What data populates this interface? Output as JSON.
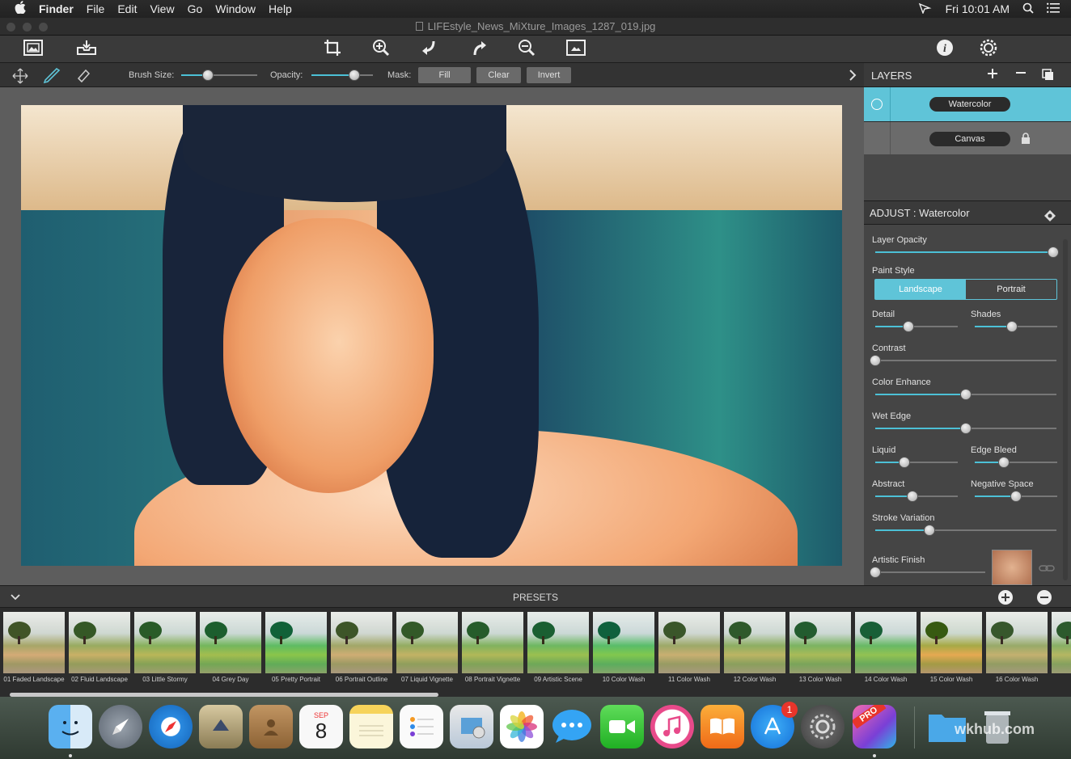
{
  "menubar": {
    "apple": "",
    "app_name": "Finder",
    "items": [
      "File",
      "Edit",
      "View",
      "Go",
      "Window",
      "Help"
    ],
    "clock": "Fri 10:01 AM"
  },
  "window": {
    "title": "LIFEstyle_News_MiXture_Images_1287_019.jpg"
  },
  "brushbar": {
    "brush_size_label": "Brush Size:",
    "brush_size": 0.35,
    "opacity_label": "Opacity:",
    "opacity": 0.7,
    "mask_label": "Mask:",
    "fill_label": "Fill",
    "clear_label": "Clear",
    "invert_label": "Invert"
  },
  "layers": {
    "title": "LAYERS",
    "items": [
      {
        "label": "Watercolor"
      },
      {
        "label": "Canvas"
      }
    ]
  },
  "adjust": {
    "title": "ADJUST : Watercolor",
    "layer_opacity_label": "Layer Opacity",
    "layer_opacity": 0.98,
    "paint_style_label": "Paint Style",
    "paint_style_options": [
      "Landscape",
      "Portrait"
    ],
    "paint_style_selected": "Landscape",
    "detail_label": "Detail",
    "detail": 0.4,
    "shades_label": "Shades",
    "shades": 0.45,
    "contrast_label": "Contrast",
    "contrast": 0.0,
    "color_enhance_label": "Color Enhance",
    "color_enhance": 0.5,
    "wet_edge_label": "Wet Edge",
    "wet_edge": 0.5,
    "liquid_label": "Liquid",
    "liquid": 0.35,
    "edge_bleed_label": "Edge Bleed",
    "edge_bleed": 0.35,
    "abstract_label": "Abstract",
    "abstract": 0.45,
    "negative_space_label": "Negative Space",
    "negative_space": 0.5,
    "stroke_variation_label": "Stroke Variation",
    "stroke_variation": 0.3,
    "artistic_finish_label": "Artistic Finish",
    "artistic_finish": 0.0
  },
  "presets": {
    "title": "PRESETS",
    "items": [
      "01 Faded Landscape",
      "02 Fluid Landscape",
      "03 Little Stormy",
      "04 Grey Day",
      "05 Pretty Portrait",
      "06 Portrait Outline",
      "07 Liquid Vignette",
      "08 Portrait Vignette",
      "09 Artistic Scene",
      "10 Color Wash",
      "11 Color Wash",
      "12 Color Wash",
      "13 Color Wash",
      "14 Color Wash",
      "15 Color Wash",
      "16 Color Wash",
      "17 T"
    ]
  },
  "dock": {
    "calendar_month": "SEP",
    "calendar_day": "8",
    "appstore_badge": "1",
    "pro_label": "PRO"
  },
  "watermark": "wkhub.com",
  "colors": {
    "accent": "#5fc4d8",
    "panel": "#454545",
    "toolbar": "#3a3a3a"
  }
}
